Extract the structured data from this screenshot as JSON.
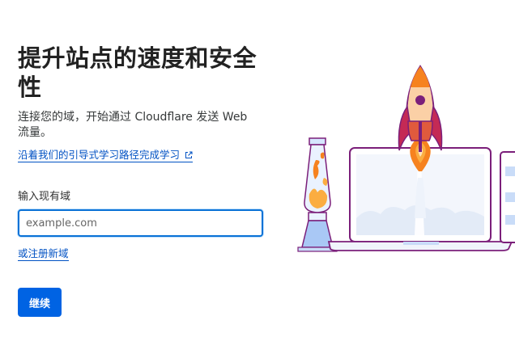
{
  "page": {
    "title": "提升站点的速度和安全性",
    "subtitle": "连接您的域，开始通过 Cloudflare 发送 Web 流量。",
    "learn_link": "沿着我们的引导式学习路径完成学习",
    "learn_link_icon": "external-link-icon"
  },
  "form": {
    "domain_label": "输入现有域",
    "domain_placeholder": "example.com",
    "domain_value": "",
    "register_link": "或注册新域",
    "continue_label": "继续"
  },
  "colors": {
    "link": "#0051c3",
    "primary_button": "#0063e3",
    "input_focus_border": "#0a72d6",
    "illustration_purple": "#7b1f7a",
    "illustration_orange": "#f6821f"
  }
}
